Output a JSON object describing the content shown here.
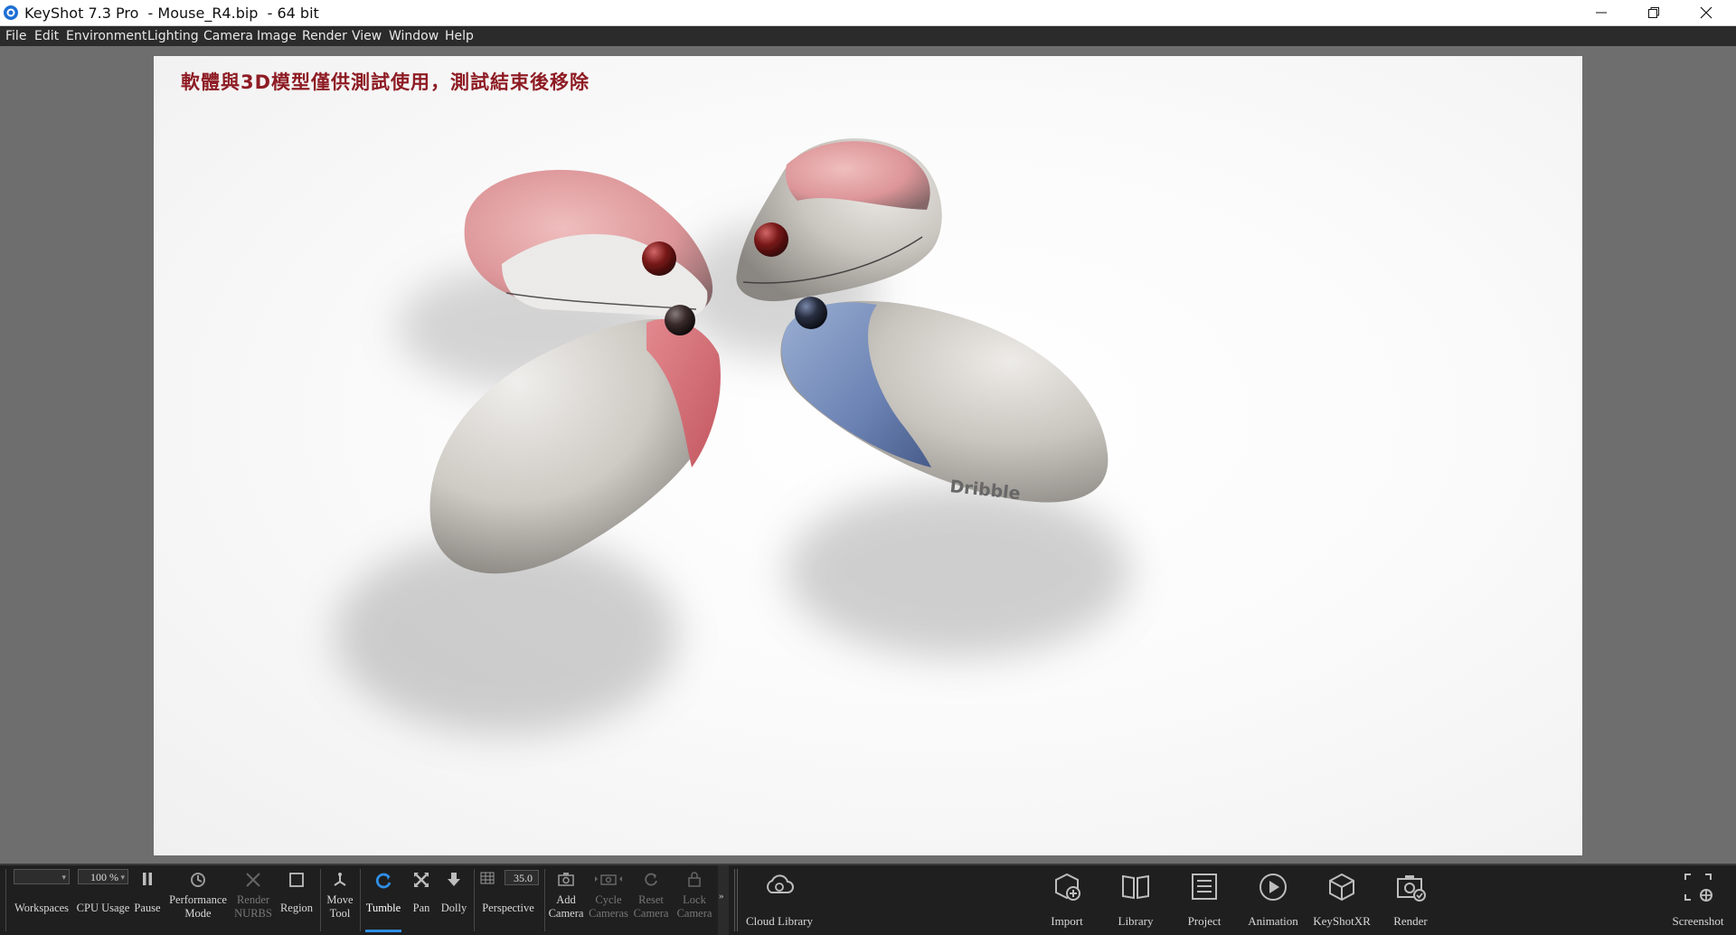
{
  "window": {
    "title": "KeyShot 7.3 Pro  - Mouse_R4.bip  - 64 bit",
    "controls": [
      "minimize-icon",
      "restore-icon",
      "close-icon"
    ]
  },
  "menu": [
    "File",
    "Edit",
    "Environment",
    "Lighting",
    "Camera",
    "Image",
    "Render",
    "View",
    "Window",
    "Help"
  ],
  "viewport": {
    "watermark": "軟體與3D模型僅供測試使用，測試結束後移除",
    "model_label": "Dribble"
  },
  "toolbar": {
    "workspace_value": "",
    "cpu_value": "100 %",
    "focal_value": "35.0",
    "items": [
      {
        "label": "Workspaces",
        "icon": "dropdown-icon",
        "enabled": true
      },
      {
        "label": "CPU Usage",
        "icon": "dropdown-icon",
        "enabled": true
      },
      {
        "label": "Pause",
        "icon": "pause-icon",
        "enabled": true
      },
      {
        "label": "Performance Mode",
        "icon": "performance-icon",
        "enabled": true
      },
      {
        "label": "Render NURBS",
        "icon": "nurbs-icon",
        "enabled": false
      },
      {
        "label": "Region",
        "icon": "region-icon",
        "enabled": true
      },
      {
        "label": "Move Tool",
        "icon": "move-tool-icon",
        "enabled": true
      },
      {
        "label": "Tumble",
        "icon": "tumble-icon",
        "enabled": true,
        "active": true
      },
      {
        "label": "Pan",
        "icon": "pan-icon",
        "enabled": true
      },
      {
        "label": "Dolly",
        "icon": "dolly-icon",
        "enabled": true
      },
      {
        "label": "Perspective",
        "icon": "perspective-icon",
        "enabled": true
      },
      {
        "label": "Add Camera",
        "icon": "add-camera-icon",
        "enabled": true
      },
      {
        "label": "Cycle Cameras",
        "icon": "cycle-cameras-icon",
        "enabled": false
      },
      {
        "label": "Reset Camera",
        "icon": "reset-camera-icon",
        "enabled": false
      },
      {
        "label": "Lock Camera",
        "icon": "lock-camera-icon",
        "enabled": false
      }
    ],
    "right_items": [
      "Cloud Library",
      "Import",
      "Library",
      "Project",
      "Animation",
      "KeyShotXR",
      "Render",
      "Screenshot"
    ]
  },
  "colors": {
    "titlebar": "#ffffff",
    "menubar": "#2b2b2b",
    "workspace": "#6e6e6e",
    "ribbon": "#1f1f1f",
    "accent": "#2f8fe6",
    "watermark": "#8e1c24"
  }
}
